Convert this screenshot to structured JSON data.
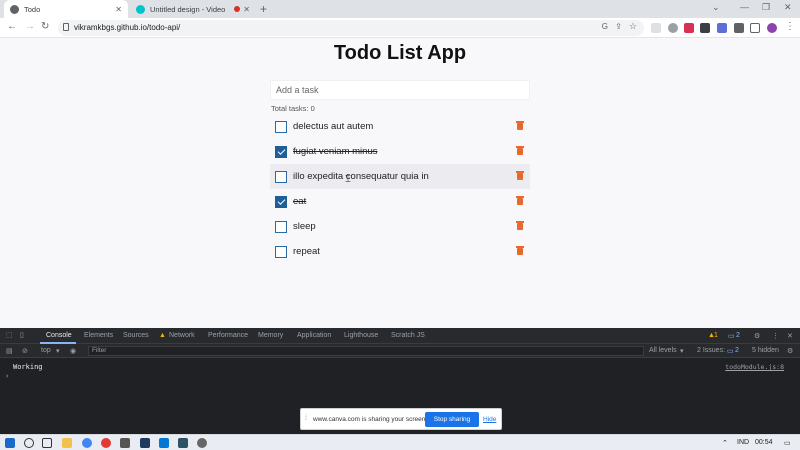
{
  "browser": {
    "tabs": [
      {
        "label": "Todo",
        "active": true
      },
      {
        "label": "Untitled design - Video",
        "active": false
      }
    ],
    "url": "vikramkbgs.github.io/todo-api/"
  },
  "app": {
    "title": "Todo List App",
    "input_placeholder": "Add a task",
    "counter": "Total tasks: 0",
    "todos": [
      {
        "text": "delectus aut autem",
        "done": false
      },
      {
        "text": "fugiat veniam minus",
        "done": true
      },
      {
        "text": "illo expedita consequatur quia in",
        "done": false
      },
      {
        "text": "eat",
        "done": true
      },
      {
        "text": "sleep",
        "done": false
      },
      {
        "text": "repeat",
        "done": false
      }
    ]
  },
  "devtools": {
    "tabs": [
      "Console",
      "Elements",
      "Sources",
      "Network",
      "Performance",
      "Memory",
      "Application",
      "Lighthouse",
      "Scratch JS"
    ],
    "context": "top",
    "filter_placeholder": "Filter",
    "levels": "All levels",
    "issues": "2 Issues:",
    "issues_count": "2",
    "hidden": "5 hidden",
    "warning_count": "1",
    "message_count": "2",
    "log_message": "Working",
    "log_source": "todoModule.js:8"
  },
  "share_bar": {
    "message": "www.canva.com is sharing your screen.",
    "stop_label": "Stop sharing",
    "hide_label": "Hide"
  },
  "taskbar": {
    "lang": "IND",
    "time": "00:54"
  }
}
